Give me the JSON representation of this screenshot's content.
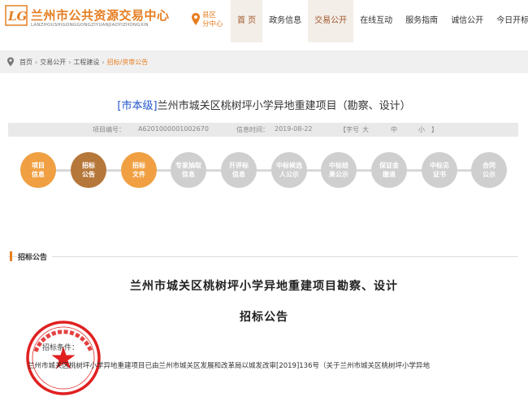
{
  "header": {
    "title": "兰州市公共资源交易中心",
    "subtitle": "LANZHOUSHIGONGGONGZIYUANJIAOYIZHONGXIN",
    "location": {
      "line1": "县区",
      "line2": "分中心"
    },
    "nav": [
      "首 页",
      "政务信息",
      "交易公开",
      "在线互动",
      "服务指南",
      "诚信公开",
      "今日开标"
    ]
  },
  "breadcrumb": [
    "首页",
    "交易公开",
    "工程建设",
    "招标/资审公告"
  ],
  "project": {
    "tag": "[市本级]",
    "name": "兰州市城关区桃树坪小学异地重建项目（勘察、设计）",
    "code_label": "项目编号：",
    "code": "A6201000001002670",
    "date_label": "信息时间：",
    "date": "2019-08-22",
    "font_label": "【字号",
    "font_sizes": [
      "大",
      "中",
      "小"
    ],
    "font_close": "】"
  },
  "steps": [
    {
      "label": "项目\n信息",
      "state": "done"
    },
    {
      "label": "招标\n公告",
      "state": "current"
    },
    {
      "label": "招标\n文件",
      "state": "done"
    },
    {
      "label": "专家抽取\n信息",
      "state": "todo"
    },
    {
      "label": "开评标\n信息",
      "state": "todo"
    },
    {
      "label": "中标候选\n人公示",
      "state": "todo"
    },
    {
      "label": "中标结\n果公示",
      "state": "todo"
    },
    {
      "label": "保证金\n缴退",
      "state": "todo"
    },
    {
      "label": "中标见\n证书",
      "state": "todo"
    },
    {
      "label": "合同\n公示",
      "state": "todo"
    }
  ],
  "section": {
    "label": "招标公告"
  },
  "document": {
    "title": "兰州市城关区桃树坪小学异地重建项目勘察、设计",
    "subtitle": "招标公告",
    "heading1": "招标条件：",
    "para1": "兰州市城关区桃树坪小学异地重建项目已由兰州市城关区发展和改革局以城发改审[2019]136号（关于兰州市城关区桃树坪小学异地"
  },
  "colors": {
    "accent": "#e67e22",
    "step_done": "#f0a042",
    "step_current": "#b6773a",
    "step_todo": "#cfcfcf",
    "tag_blue": "#2255cc",
    "seal_red": "#e02020"
  }
}
